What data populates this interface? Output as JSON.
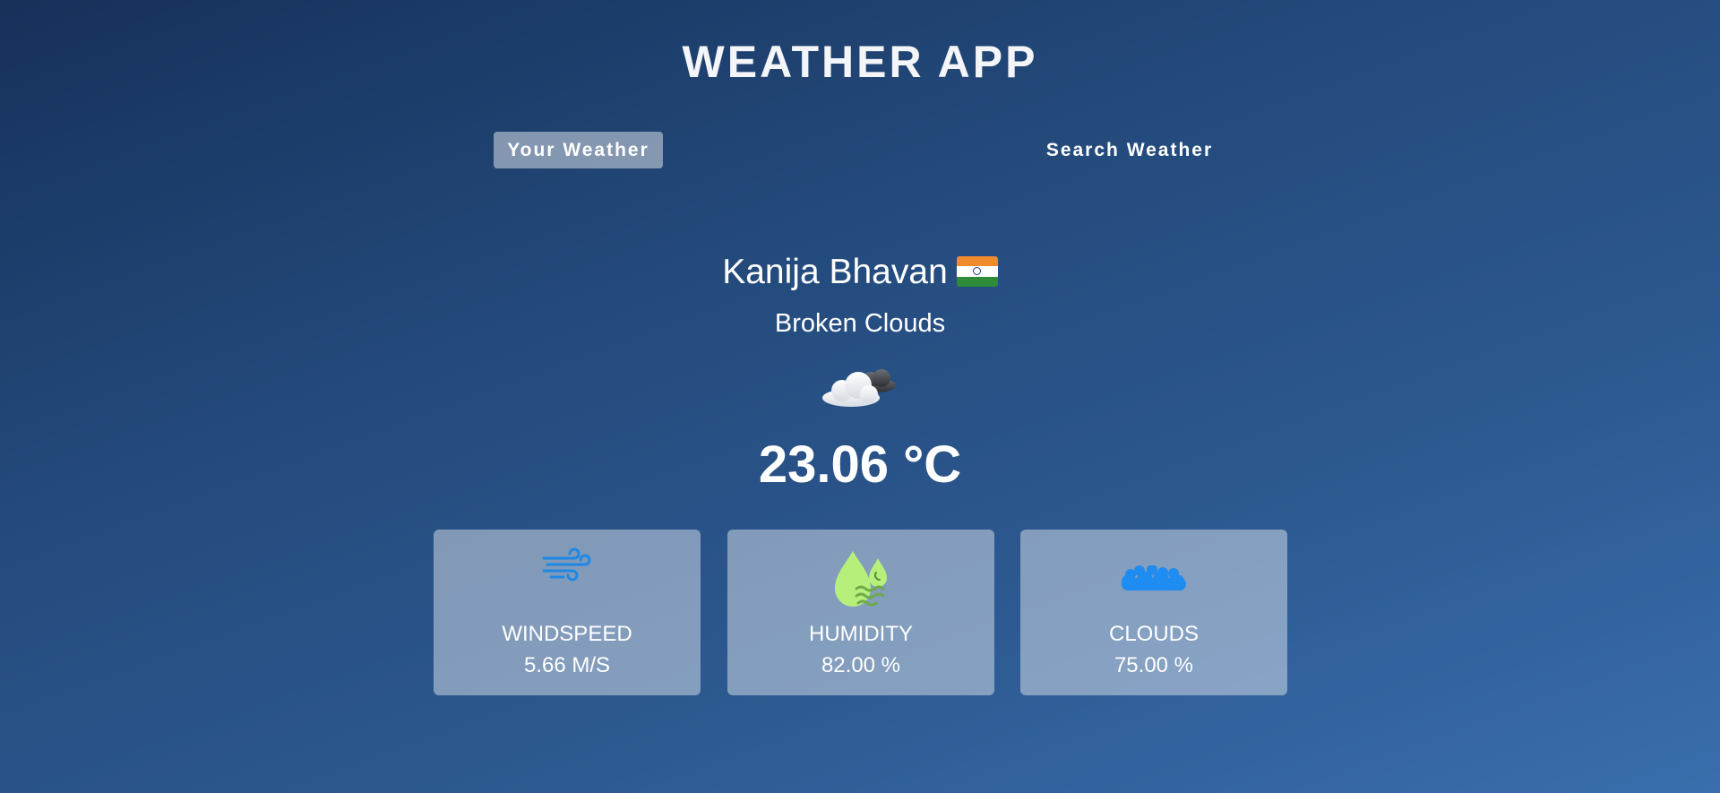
{
  "app": {
    "title": "WEATHER APP"
  },
  "tabs": [
    {
      "label": "Your Weather",
      "active": true
    },
    {
      "label": "Search Weather",
      "active": false
    }
  ],
  "location": {
    "city": "Kanija Bhavan",
    "country_flag": "india-flag-icon"
  },
  "weather": {
    "description": "Broken Clouds",
    "icon": "broken-clouds-icon",
    "temperature": "23.06 °C"
  },
  "metrics": [
    {
      "label": "WINDSPEED",
      "value": "5.66 M/S",
      "icon": "wind-icon",
      "color": "#1e88e5"
    },
    {
      "label": "HUMIDITY",
      "value": "82.00 %",
      "icon": "humidity-icon",
      "color": "#b6f07a"
    },
    {
      "label": "CLOUDS",
      "value": "75.00 %",
      "icon": "clouds-icon",
      "color": "#1e8cf0"
    }
  ],
  "colors": {
    "bg_top": "#16315a",
    "bg_bottom": "#3a6eac",
    "card_bg": "rgba(255,255,255,0.42)"
  }
}
